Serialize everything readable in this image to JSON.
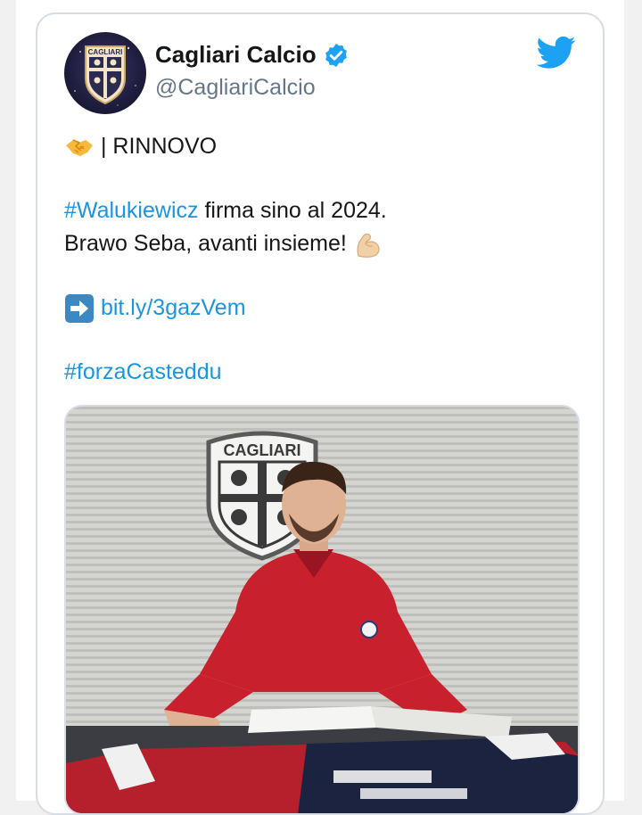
{
  "tweet": {
    "author": {
      "name": "Cagliari Calcio",
      "handle": "@CagliariCalcio",
      "avatar_text": "CAGLIARI",
      "verified": true
    },
    "text": {
      "line1_label": "| RINNOVO",
      "hashtag_player": "#Walukiewicz",
      "line2_rest": " firma sino al 2024.",
      "line3": "Brawo Seba, avanti insieme!",
      "link": "bit.ly/3gazVem",
      "hashtag_team": "#forzaCasteddu"
    },
    "media": {
      "crest_text": "CAGLIARI"
    },
    "colors": {
      "link": "#1b95e0",
      "twitter_blue": "#1da1f2",
      "text": "#14171a",
      "muted": "#657786"
    },
    "icons": [
      "handshake-emoji",
      "flexed-biceps-emoji",
      "right-arrow-emoji",
      "verified-badge-icon",
      "twitter-bird-icon"
    ]
  }
}
